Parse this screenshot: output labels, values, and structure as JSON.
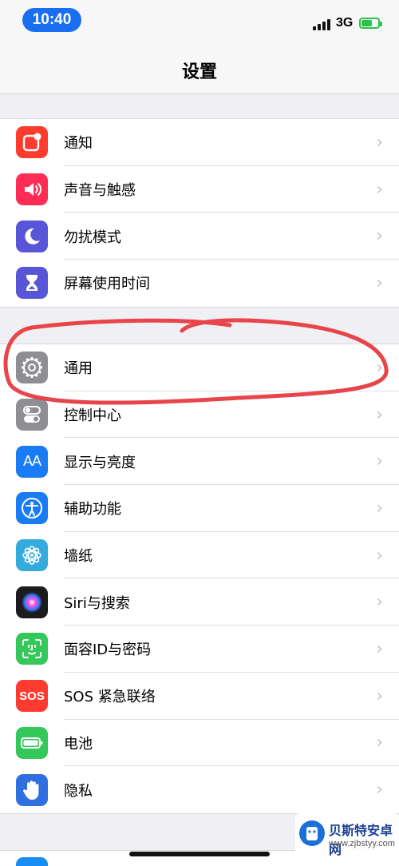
{
  "status_bar": {
    "time": "10:40",
    "network": "3G",
    "battery_level": 0.6,
    "battery_color": "#2bc24a",
    "time_pill_color": "#1a6ff0"
  },
  "header": {
    "title": "设置"
  },
  "groups": [
    {
      "items": [
        {
          "label": "通知",
          "icon": "notifications-icon",
          "color": "#ff3b30"
        },
        {
          "label": "声音与触感",
          "icon": "speaker-icon",
          "color": "#ff2d55"
        },
        {
          "label": "勿扰模式",
          "icon": "moon-icon",
          "color": "#5856d6"
        },
        {
          "label": "屏幕使用时间",
          "icon": "hourglass-icon",
          "color": "#5856d6"
        }
      ]
    },
    {
      "items": [
        {
          "label": "通用",
          "icon": "gear-icon",
          "color": "#8e8e93"
        },
        {
          "label": "控制中心",
          "icon": "toggle-icon",
          "color": "#8e8e93"
        },
        {
          "label": "显示与亮度",
          "icon": "text-size-icon",
          "color": "#1a7cf5"
        },
        {
          "label": "辅助功能",
          "icon": "accessibility-icon",
          "color": "#1a7cf5"
        },
        {
          "label": "墙纸",
          "icon": "flower-icon",
          "color": "#35aadc"
        },
        {
          "label": "Siri与搜索",
          "icon": "siri-icon",
          "color": "#1c1c1e"
        },
        {
          "label": "面容ID与密码",
          "icon": "face-id-icon",
          "color": "#34c759"
        },
        {
          "label": "SOS 紧急联络",
          "icon": "sos-icon",
          "color": "#ff3b30"
        },
        {
          "label": "电池",
          "icon": "battery-icon",
          "color": "#34c759"
        },
        {
          "label": "隐私",
          "icon": "hand-icon",
          "color": "#2f6fe0"
        }
      ]
    }
  ],
  "sos_icon_text": "SOS",
  "text_size_icon_text": "AA",
  "watermark": {
    "title": "贝斯特安卓网",
    "url": "www.zjbstyy.com"
  },
  "annotation_color": "#e8454a"
}
